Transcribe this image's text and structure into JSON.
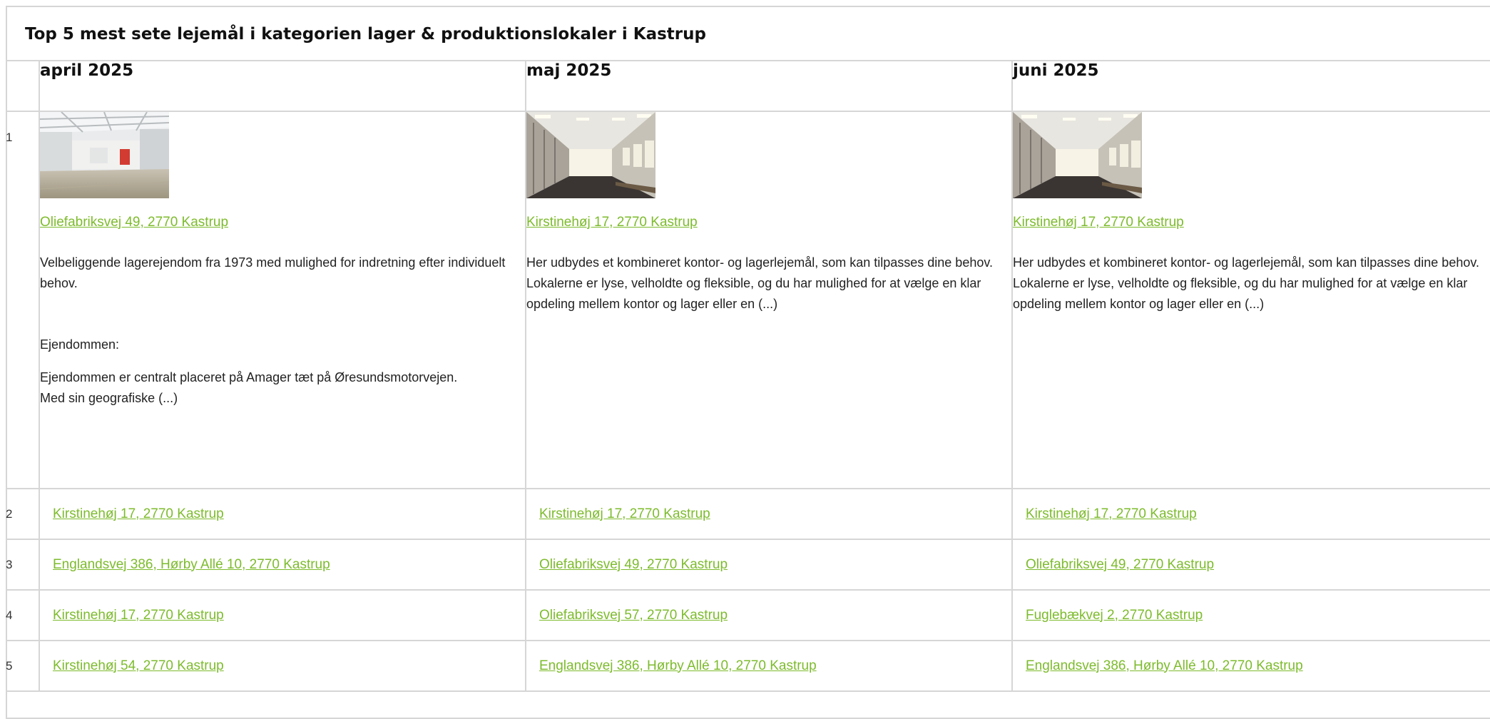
{
  "title": "Top 5 mest sete lejemål i kategorien lager & produktionslokaler i Kastrup",
  "columns": [
    "april 2025",
    "maj 2025",
    "juni 2025"
  ],
  "ranks": [
    "1",
    "2",
    "3",
    "4",
    "5"
  ],
  "featured": [
    {
      "image": "warehouse-photo",
      "address": "Oliefabriksvej 49, 2770 Kastrup",
      "paragraphs": [
        "Velbeliggende lagerejendom fra 1973 med mulighed for indretning efter individuelt behov.",
        "Ejendommen:",
        "Ejendommen er centralt placeret på Amager tæt på Øresundsmotorvejen.",
        "Med sin geografiske (...)"
      ]
    },
    {
      "image": "office-corridor-photo",
      "address": "Kirstinehøj 17, 2770 Kastrup",
      "paragraphs": [
        "Her udbydes et kombineret kontor- og lagerlejemål, som kan tilpasses dine behov. Lokalerne er lyse, velholdte og fleksible, og du har mulighed for at vælge en klar opdeling mellem kontor og lager eller en (...)"
      ]
    },
    {
      "image": "office-corridor-photo",
      "address": "Kirstinehøj 17, 2770 Kastrup",
      "paragraphs": [
        "Her udbydes et kombineret kontor- og lagerlejemål, som kan tilpasses dine behov. Lokalerne er lyse, velholdte og fleksible, og du har mulighed for at vælge en klar opdeling mellem kontor og lager eller en (...)"
      ]
    }
  ],
  "rows": [
    [
      "Kirstinehøj 17, 2770 Kastrup",
      "Kirstinehøj 17, 2770 Kastrup",
      "Kirstinehøj 17, 2770 Kastrup"
    ],
    [
      "Englandsvej 386, Hørby Allé 10, 2770 Kastrup",
      "Oliefabriksvej 49, 2770 Kastrup",
      "Oliefabriksvej 49, 2770 Kastrup"
    ],
    [
      "Kirstinehøj 17, 2770 Kastrup",
      "Oliefabriksvej 57, 2770 Kastrup",
      "Fuglebækvej 2, 2770 Kastrup"
    ],
    [
      "Kirstinehøj 54, 2770 Kastrup",
      "Englandsvej 386, Hørby Allé 10, 2770 Kastrup",
      "Englandsvej 386, Hørby Allé 10, 2770 Kastrup"
    ]
  ],
  "colors": {
    "link": "#7dbb2c",
    "border": "#d6d6d6",
    "text": "#222222"
  }
}
